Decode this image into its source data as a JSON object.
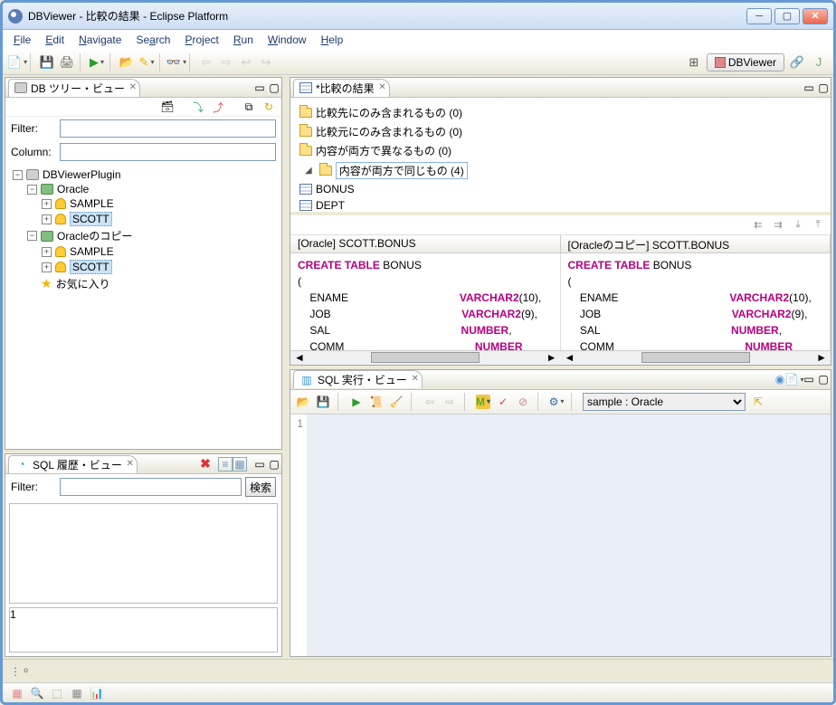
{
  "title": "DBViewer - 比較の結果 - Eclipse Platform",
  "menu": {
    "file": "File",
    "edit": "Edit",
    "nav": "Navigate",
    "search": "Search",
    "project": "Project",
    "run": "Run",
    "window": "Window",
    "help": "Help"
  },
  "perspective": {
    "label": "DBViewer"
  },
  "dbtree": {
    "tab": "DB ツリー・ビュー",
    "filter_label": "Filter:",
    "column_label": "Column:",
    "nodes": {
      "root": "DBViewerPlugin",
      "oracle": "Oracle",
      "sample1": "SAMPLE",
      "scott1": "SCOTT",
      "oraclecopy": "Oracleのコピー",
      "sample2": "SAMPLE",
      "scott2": "SCOTT",
      "fav": "お気に入り"
    }
  },
  "compare": {
    "tab": "*比較の結果",
    "tree": {
      "t1": "比較先にのみ含まれるもの (0)",
      "t2": "比較元にのみ含まれるもの (0)",
      "t3": "内容が両方で異なるもの (0)",
      "t4": "内容が両方で同じもの (4)",
      "bonus": "BONUS",
      "dept": "DEPT"
    },
    "head_left": "[Oracle] SCOTT.BONUS",
    "head_right": "[Oracleのコピー] SCOTT.BONUS",
    "sql": {
      "create": "CREATE TABLE",
      "tname": " BONUS",
      "lparen": "(",
      "c1": "    ENAME",
      "t1": "VARCHAR2",
      "a1": "(10),",
      "c2": "    JOB",
      "t2": "VARCHAR2",
      "a2": "(9),",
      "c3": "    SAL",
      "t3": "NUMBER",
      "a3": ",",
      "c4": "    COMM",
      "t4": "NUMBER",
      "a4": "",
      "rparen": ")",
      "slash": "/"
    }
  },
  "history": {
    "tab": "SQL 履歴・ビュー",
    "filter_label": "Filter:",
    "search_btn": "検索",
    "line": "1"
  },
  "sqlexec": {
    "tab": "SQL 実行・ビュー",
    "conn": "sample : Oracle",
    "line": "1"
  },
  "footer": {
    "cons": "",
    "stats": ""
  }
}
